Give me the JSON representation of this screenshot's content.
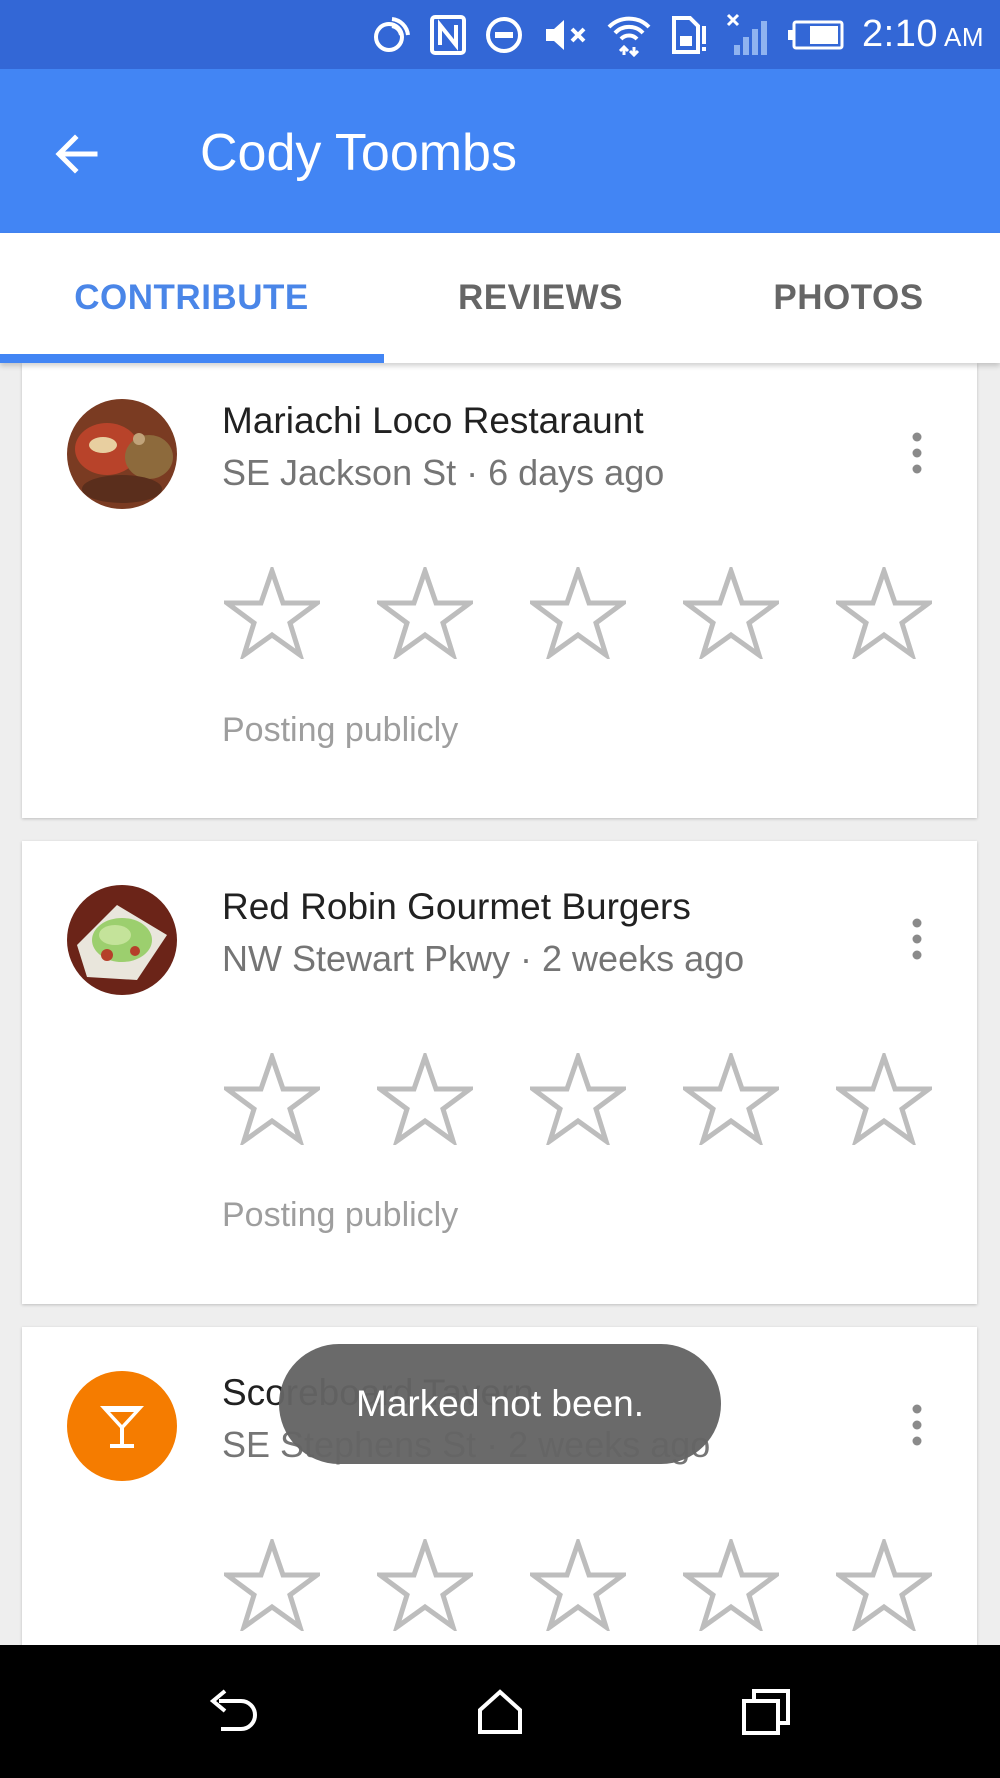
{
  "status_bar": {
    "time": "2:10",
    "ampm": "AM",
    "icons": [
      "nfc-signal-icon",
      "nfc-n-icon",
      "do-not-disturb-icon",
      "volume-muted-icon",
      "wifi-icon",
      "sim-alert-icon",
      "cell-signal-none-icon",
      "battery-icon"
    ]
  },
  "app_bar": {
    "title": "Cody Toombs",
    "back_icon": "arrow-back-icon"
  },
  "tabs": [
    {
      "label": "CONTRIBUTE",
      "active": true
    },
    {
      "label": "REVIEWS",
      "active": false
    },
    {
      "label": "PHOTOS",
      "active": false
    }
  ],
  "cards": [
    {
      "name": "Mariachi Loco Restaraunt",
      "meta": "SE Jackson St · 6 days ago",
      "avatar": "food-photo-enchiladas",
      "rating": 0,
      "max_rating": 5,
      "visibility": "Posting publicly"
    },
    {
      "name": "Red Robin Gourmet Burgers",
      "meta": "NW Stewart Pkwy · 2 weeks ago",
      "avatar": "food-photo-nachos",
      "rating": 0,
      "max_rating": 5,
      "visibility": "Posting publicly"
    },
    {
      "name": "Scoreboard Tavern",
      "meta": "SE Stephens St · 2 weeks ago",
      "avatar": "bar-cocktail-icon",
      "avatar_color": "#f57c00",
      "rating": 0,
      "max_rating": 5
    }
  ],
  "toast": {
    "message": "Marked not been."
  },
  "nav_bar": {
    "icons": [
      "back-nav-icon",
      "home-nav-icon",
      "recents-nav-icon"
    ]
  },
  "colors": {
    "status_bar": "#3367d6",
    "app_bar": "#4285f4",
    "accent": "#4a86e8"
  }
}
